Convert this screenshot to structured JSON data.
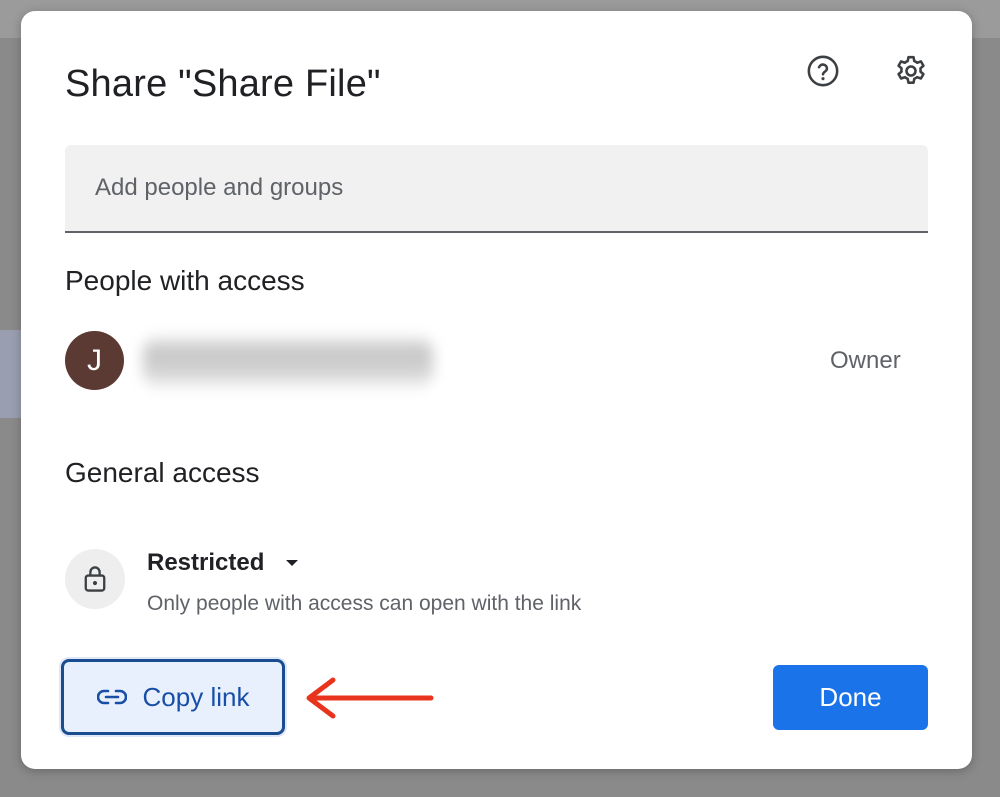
{
  "dialog": {
    "title": "Share \"Share File\"",
    "help_icon": "help-circle-icon",
    "settings_icon": "gear-icon"
  },
  "add_people": {
    "placeholder": "Add people and groups",
    "value": ""
  },
  "people_section": {
    "heading": "People with access",
    "people": [
      {
        "initial": "J",
        "avatar_color": "#5b3a33",
        "name_redacted": true,
        "role": "Owner"
      }
    ]
  },
  "general_access": {
    "heading": "General access",
    "icon": "lock-icon",
    "selected": "Restricted",
    "description": "Only people with access can open with the link"
  },
  "actions": {
    "copy_link_icon": "link-icon",
    "copy_link_label": "Copy link",
    "done_label": "Done"
  },
  "colors": {
    "primary": "#1a73e8",
    "copy_link_bg": "#e8f0fe",
    "annotation_arrow": "#e8341c"
  }
}
